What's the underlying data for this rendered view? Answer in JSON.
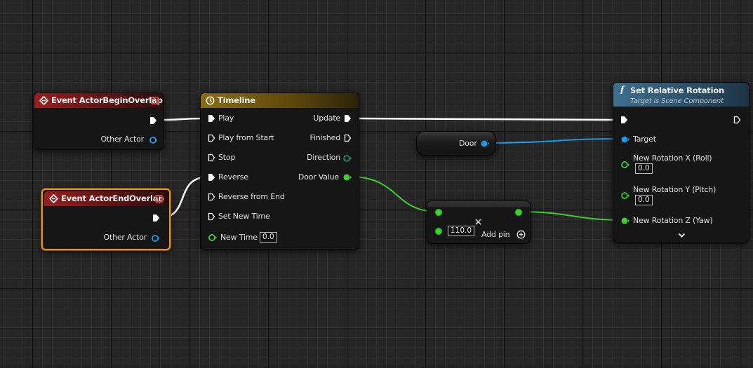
{
  "event_begin": {
    "title": "Event ActorBeginOverlap",
    "other_actor": "Other Actor"
  },
  "event_end": {
    "title": "Event ActorEndOverlap",
    "other_actor": "Other Actor"
  },
  "timeline": {
    "title": "Timeline",
    "inputs": {
      "play": "Play",
      "play_from_start": "Play from Start",
      "stop": "Stop",
      "reverse": "Reverse",
      "reverse_from_end": "Reverse from End",
      "set_new_time": "Set New Time",
      "new_time": "New Time"
    },
    "new_time_value": "0.0",
    "outputs": {
      "update": "Update",
      "finished": "Finished",
      "direction": "Direction",
      "door_value": "Door Value"
    }
  },
  "door_var": {
    "label": "Door"
  },
  "add_node": {
    "value": "110.0",
    "add_pin": "Add pin"
  },
  "set_rotation": {
    "title": "Set Relative Rotation",
    "subtitle": "Target is Scene Component",
    "target": "Target",
    "roll": "New Rotation X (Roll)",
    "roll_value": "0.0",
    "pitch": "New Rotation Y (Pitch)",
    "pitch_value": "0.0",
    "yaw": "New Rotation Z (Yaw)"
  },
  "colors": {
    "exec": "#ffffff",
    "object": "#1c9ae8",
    "float": "#3ccf2f",
    "selected": "#e6931b"
  },
  "icons": {
    "event": "event-diamond-icon",
    "timeline": "clock-icon",
    "function": "function-f-icon",
    "add_pin": "plus-circle-icon",
    "expand": "chevron-down-icon",
    "remove": "close-x-icon"
  }
}
